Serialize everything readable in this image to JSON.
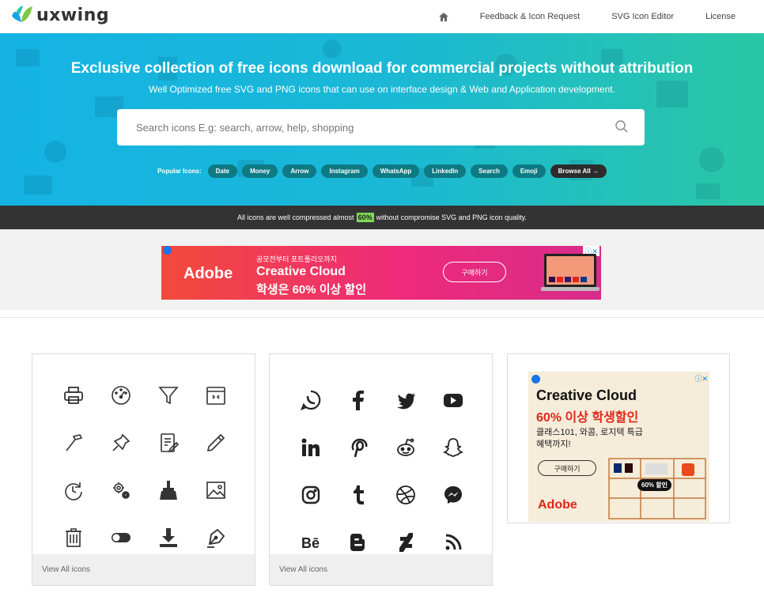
{
  "nav": {
    "logo_text": "uxwing",
    "home_icon": "home-icon",
    "links": [
      "Feedback & Icon Request",
      "SVG Icon Editor",
      "License"
    ]
  },
  "hero": {
    "title": "Exclusive collection of free icons download for commercial projects without attribution",
    "subtitle": "Well Optimized free SVG and PNG icons that can use on interface design & Web and Application development.",
    "search_placeholder": "Search icons E.g: search, arrow, help, shopping",
    "popular_label": "Popular Icons:",
    "chips": [
      "Date",
      "Money",
      "Arrow",
      "Instagram",
      "WhatsApp",
      "LinkedIn",
      "Search",
      "Emoji"
    ],
    "browse_all": "Browse All →"
  },
  "strip": {
    "before": "All icons are well compressed almost",
    "pct": "60%",
    "after": "without compromise SVG and PNG icon quality."
  },
  "banner_ad": {
    "brand": "Adobe",
    "line1": "공모전부터 포트폴리오까지",
    "line2": "Creative Cloud",
    "line3": "학생은 60% 이상 할인",
    "button": "구매하기"
  },
  "cards": [
    {
      "icons": [
        "printer-icon",
        "speedometer-icon",
        "filter-icon",
        "calendar-icon",
        "hammer-icon",
        "pin-icon",
        "document-edit-icon",
        "pencil-icon",
        "refresh-clock-icon",
        "settings-gears-icon",
        "broom-icon",
        "image-icon",
        "trash-icon",
        "toggle-icon",
        "download-icon",
        "pen-nib-icon"
      ],
      "footer": "View All icons"
    },
    {
      "icons": [
        "whatsapp-icon",
        "facebook-icon",
        "twitter-icon",
        "youtube-icon",
        "linkedin-icon",
        "pinterest-icon",
        "reddit-icon",
        "snapchat-icon",
        "instagram-icon",
        "tumblr-icon",
        "dribbble-icon",
        "messenger-icon",
        "behance-icon",
        "blogger-icon",
        "deviantart-icon",
        "rss-icon"
      ],
      "footer": "View All icons"
    }
  ],
  "side_ad": {
    "title": "Creative Cloud",
    "subtitle": "60% 이상 학생할인",
    "desc": "클래스101, 와콤, 로지텍 특급 혜택까지!",
    "button": "구매하기",
    "brand": "Adobe",
    "badge": "60% 할인"
  },
  "colors": {
    "hero_start": "#14b3e4",
    "hero_end": "#2ac7a6",
    "chip": "#0e7a84",
    "strip": "#333333",
    "pct": "#7ed957"
  }
}
